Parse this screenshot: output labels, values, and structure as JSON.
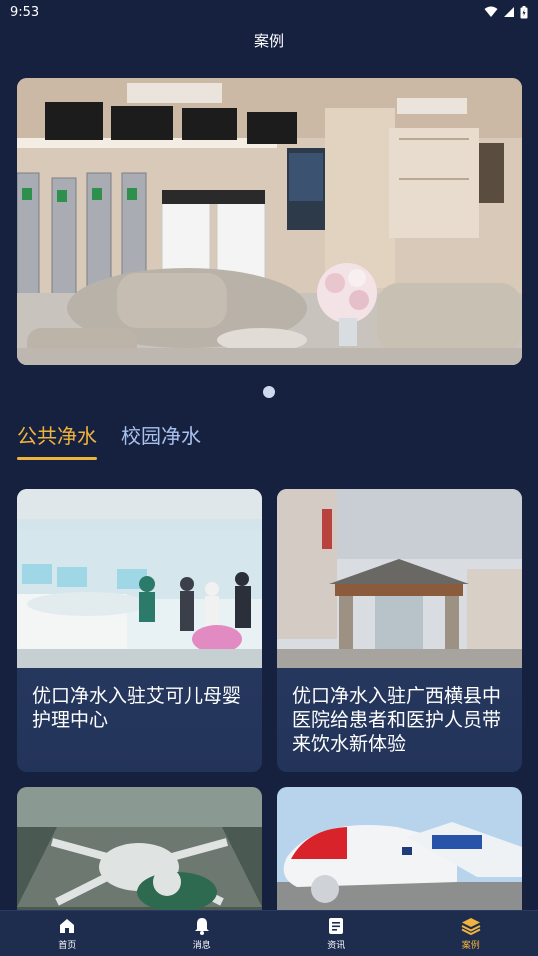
{
  "status_bar": {
    "time": "9:53"
  },
  "header": {
    "title": "案例"
  },
  "tabs": [
    {
      "label": "公共净水",
      "active": true
    },
    {
      "label": "校园净水",
      "active": false
    }
  ],
  "cards": [
    {
      "title": "优口净水入驻艾可儿母婴护理中心"
    },
    {
      "title": "优口净水入驻广西横县中医院给患者和医护人员带来饮水新体验"
    },
    {
      "title": ""
    },
    {
      "title": ""
    }
  ],
  "bottom_nav": [
    {
      "label": "首页",
      "icon": "home-icon"
    },
    {
      "label": "消息",
      "icon": "bell-icon"
    },
    {
      "label": "资讯",
      "icon": "news-icon"
    },
    {
      "label": "案例",
      "icon": "layers-icon",
      "active": true
    }
  ],
  "colors": {
    "background": "#162140",
    "accent": "#f0b43d",
    "tab_inactive": "#a9c1ee"
  }
}
